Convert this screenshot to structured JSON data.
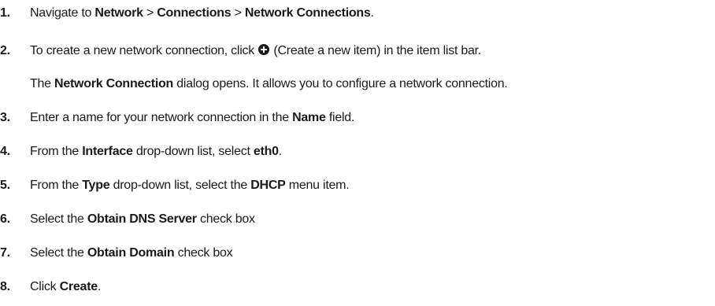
{
  "steps": [
    {
      "number": "1.",
      "t1": "Navigate to ",
      "b1": "Network",
      "t2": " > ",
      "b2": "Connections",
      "t3": " > ",
      "b3": "Network Connections",
      "t4": "."
    },
    {
      "number": "2.",
      "t1": "To create a new network connection, click ",
      "icon": "plus-circle-icon",
      "t2": " (Create a new item) in the item list bar."
    },
    {
      "t1": "The ",
      "b1": "Network Connection",
      "t2": " dialog opens. It allows you to configure a network connection."
    },
    {
      "number": "3.",
      "t1": "Enter a name for your network connection in the ",
      "b1": "Name",
      "t2": " field."
    },
    {
      "number": "4.",
      "t1": "From the ",
      "b1": "Interface",
      "t2": " drop-down list, select ",
      "b2": "eth0",
      "t3": "."
    },
    {
      "number": "5.",
      "t1": "From the ",
      "b1": "Type",
      "t2": " drop-down list, select the ",
      "b2": "DHCP",
      "t3": " menu item."
    },
    {
      "number": "6.",
      "t1": "Select the ",
      "b1": "Obtain DNS Server",
      "t2": " check box"
    },
    {
      "number": "7.",
      "t1": "Select the ",
      "b1": "Obtain Domain",
      "t2": " check box"
    },
    {
      "number": "8.",
      "t1": "Click ",
      "b1": "Create",
      "t2": "."
    }
  ]
}
